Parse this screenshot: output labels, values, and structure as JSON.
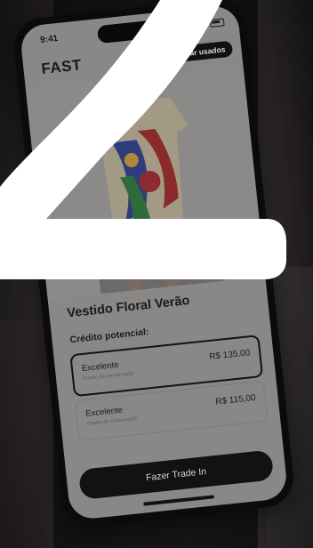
{
  "status_bar": {
    "time": "9:41"
  },
  "header": {
    "brand": "FAST",
    "pill_label": "Comprar usados"
  },
  "product": {
    "title": "Vestido Floral Verão"
  },
  "credit": {
    "label": "Crédito potencial:",
    "options": [
      {
        "condition": "Excelente",
        "subtitle": "Estado de conservação",
        "price": "R$ 135,00",
        "selected": true
      },
      {
        "condition": "Excelente",
        "subtitle": "Estado de conservação",
        "price": "R$ 115,00",
        "selected": false
      }
    ]
  },
  "cta": {
    "label": "Fazer Trade In"
  },
  "overlay": {
    "digit": "2"
  }
}
